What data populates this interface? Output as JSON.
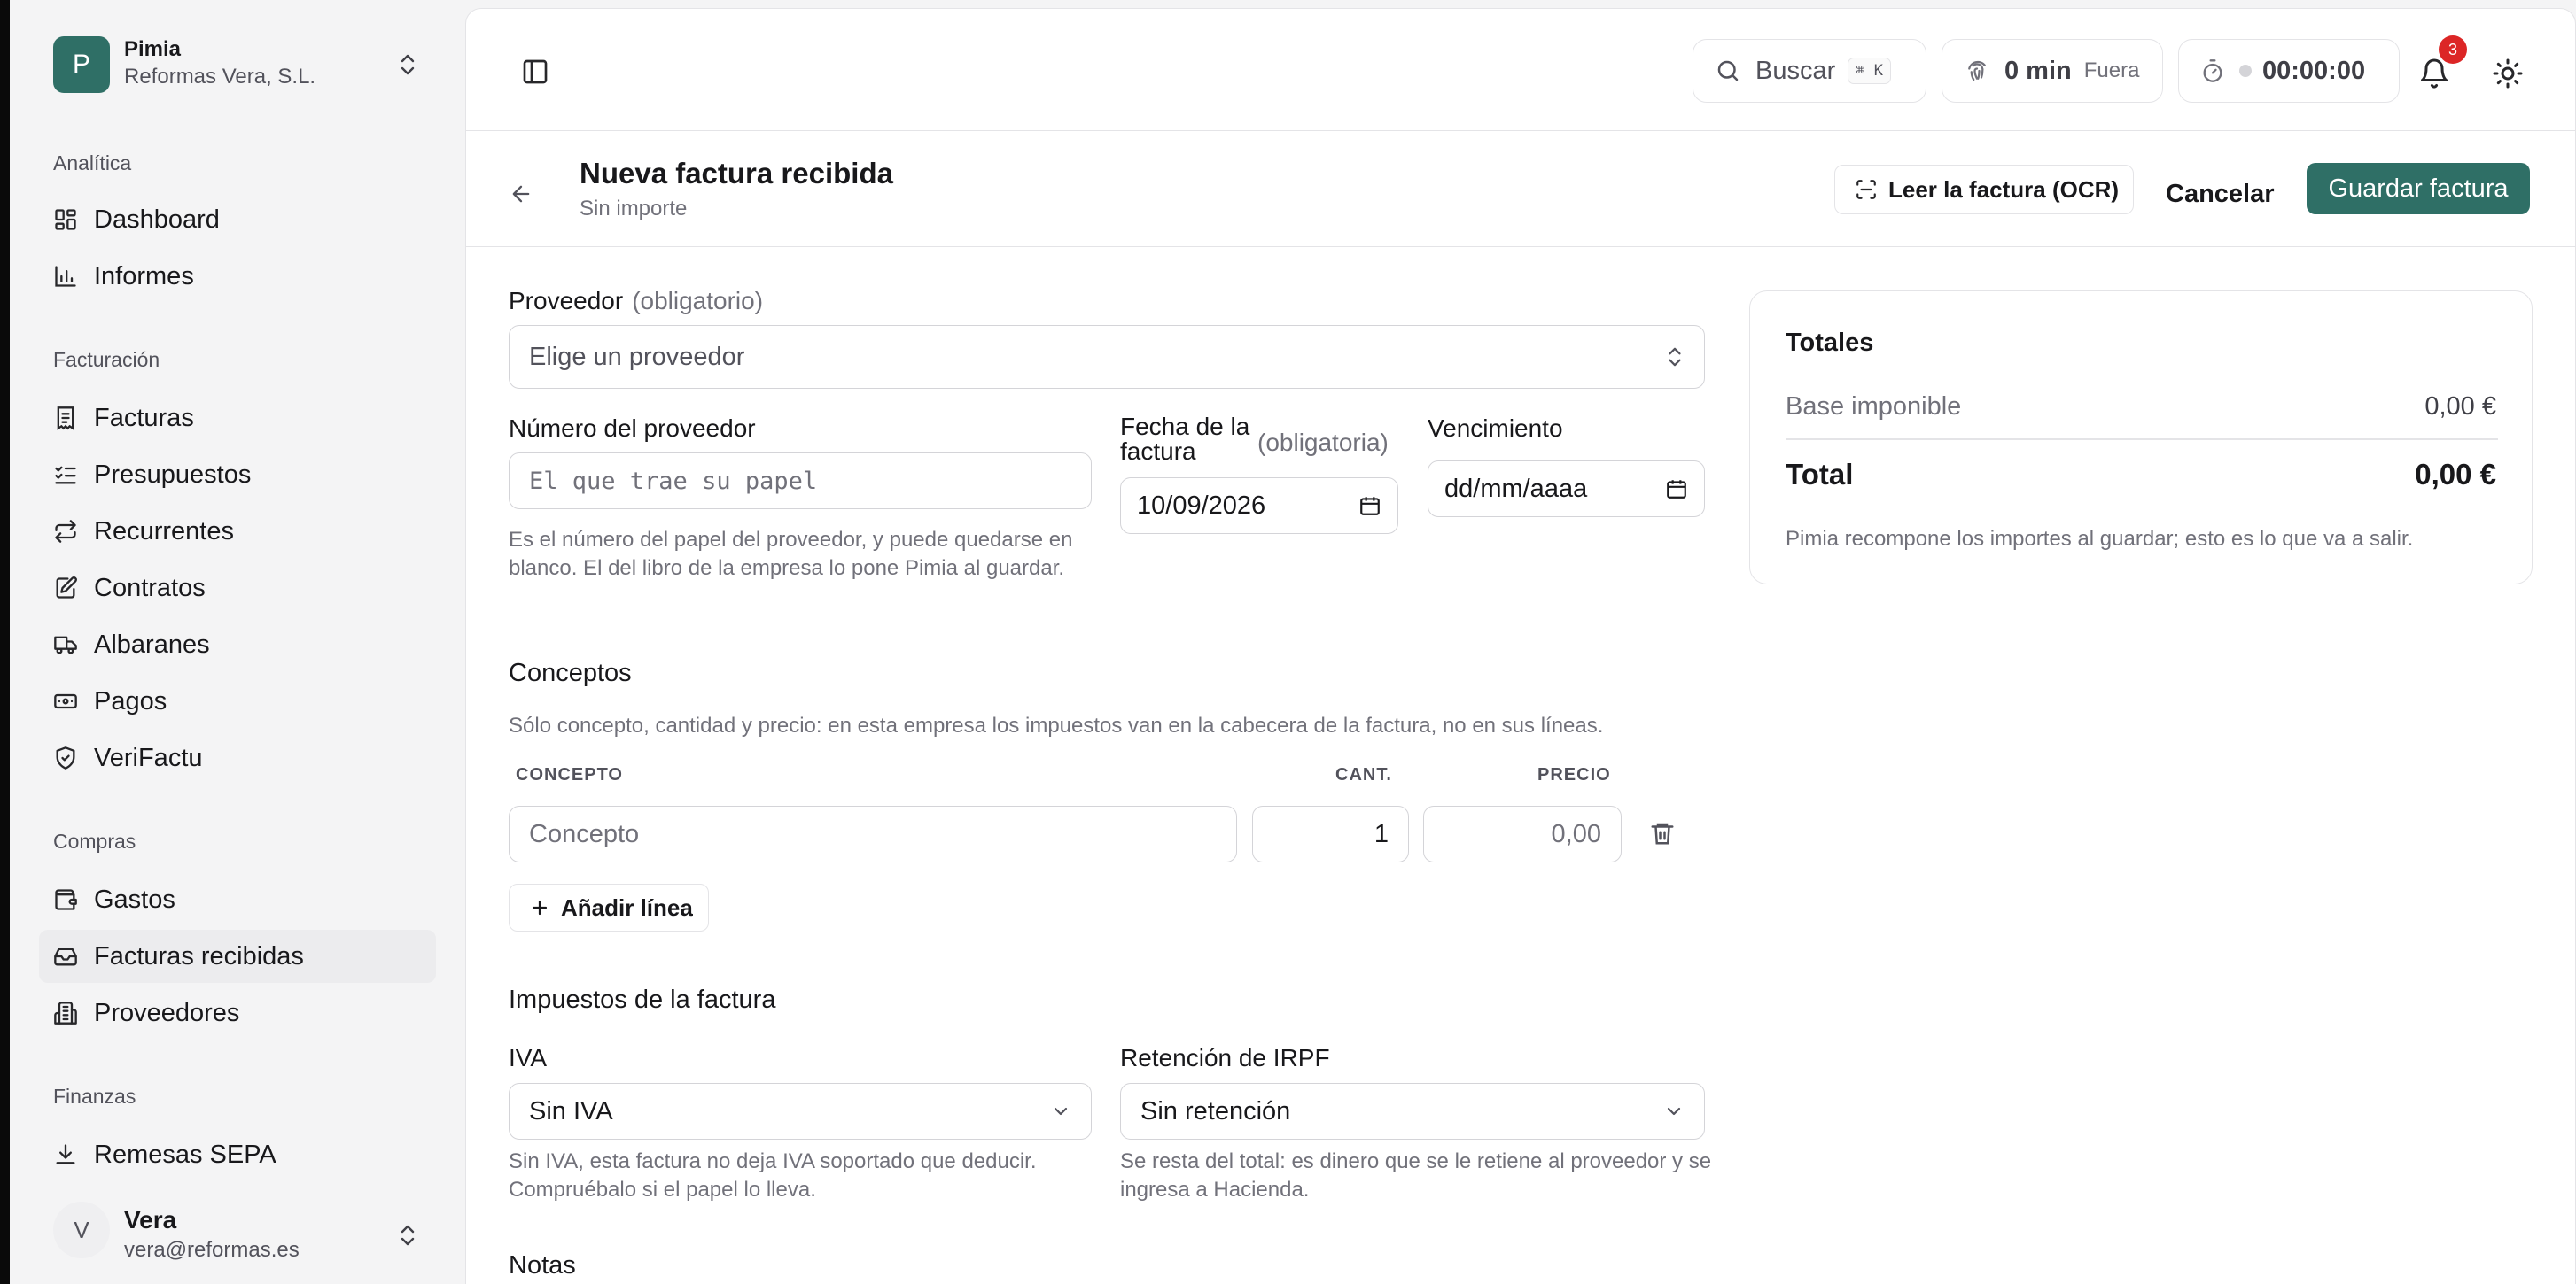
{
  "org": {
    "initial": "P",
    "name": "Pimia",
    "company": "Reformas Vera, S.L."
  },
  "sidebar": {
    "groups": [
      {
        "label": "Analítica",
        "items": [
          {
            "label": "Dashboard",
            "icon": "dashboard-icon"
          },
          {
            "label": "Informes",
            "icon": "chart-icon"
          }
        ]
      },
      {
        "label": "Facturación",
        "items": [
          {
            "label": "Facturas",
            "icon": "receipt-icon"
          },
          {
            "label": "Presupuestos",
            "icon": "checklist-icon"
          },
          {
            "label": "Recurrentes",
            "icon": "repeat-icon"
          },
          {
            "label": "Contratos",
            "icon": "contract-icon"
          },
          {
            "label": "Albaranes",
            "icon": "truck-icon"
          },
          {
            "label": "Pagos",
            "icon": "banknote-icon"
          },
          {
            "label": "VeriFactu",
            "icon": "shield-check-icon"
          }
        ]
      },
      {
        "label": "Compras",
        "items": [
          {
            "label": "Gastos",
            "icon": "wallet-icon"
          },
          {
            "label": "Facturas recibidas",
            "icon": "inbox-icon"
          },
          {
            "label": "Proveedores",
            "icon": "building-icon"
          }
        ]
      },
      {
        "label": "Finanzas",
        "items": [
          {
            "label": "Remesas SEPA",
            "icon": "download-icon"
          }
        ]
      }
    ]
  },
  "user": {
    "initial": "V",
    "name": "Vera",
    "email": "vera@reformas.es"
  },
  "topbar": {
    "search_label": "Buscar",
    "search_kbd": "⌘ K",
    "time_value": "0 min",
    "time_status": "Fuera",
    "timer": "00:00:00",
    "notifications_count": "3"
  },
  "page": {
    "title": "Nueva factura recibida",
    "subtitle": "Sin importe",
    "ocr_button": "Leer la factura (OCR)",
    "cancel_button": "Cancelar",
    "save_button": "Guardar factura"
  },
  "form": {
    "provider_label": "Proveedor",
    "provider_required": "(obligatorio)",
    "provider_placeholder": "Elige un proveedor",
    "number_label": "Número del proveedor",
    "number_placeholder": "El que trae su papel",
    "number_help": "Es el número del papel del proveedor, y puede quedarse en blanco. El del libro de la empresa lo pone Pimia al guardar.",
    "date_label": "Fecha de la factura",
    "date_required": "(obligatoria)",
    "date_value": "10/09/2026",
    "due_label": "Vencimiento",
    "due_placeholder": "dd/mm/aaaa",
    "concepts_title": "Conceptos",
    "concepts_help": "Sólo concepto, cantidad y precio: en esta empresa los impuestos van en la cabecera de la factura, no en sus líneas.",
    "col_concept": "CONCEPTO",
    "col_qty": "CANT.",
    "col_price": "PRECIO",
    "line": {
      "concept_placeholder": "Concepto",
      "qty": "1",
      "price_placeholder": "0,00"
    },
    "add_line": "Añadir línea",
    "taxes_title": "Impuestos de la factura",
    "iva_label": "IVA",
    "iva_value": "Sin IVA",
    "iva_help": "Sin IVA, esta factura no deja IVA soportado que deducir. Compruébalo si el papel lo lleva.",
    "irpf_label": "Retención de IRPF",
    "irpf_value": "Sin retención",
    "irpf_help": "Se resta del total: es dinero que se le retiene al proveedor y se ingresa a Hacienda.",
    "notes_title": "Notas"
  },
  "totals": {
    "title": "Totales",
    "base_label": "Base imponible",
    "base_value": "0,00 €",
    "total_label": "Total",
    "total_value": "0,00 €",
    "note": "Pimia recompone los importes al guardar; esto es lo que va a salir."
  }
}
